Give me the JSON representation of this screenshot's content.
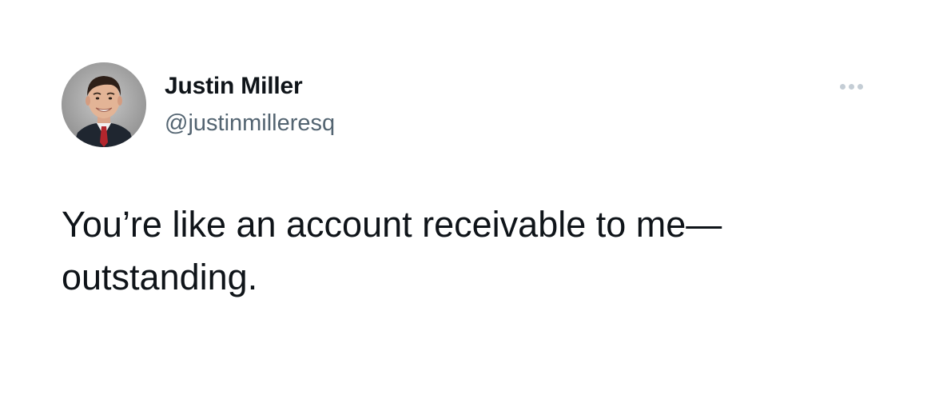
{
  "tweet": {
    "author": {
      "display_name": "Justin Miller",
      "handle": "@justinmilleresq",
      "avatar_icon": "user-avatar-photo"
    },
    "more_icon": "more-options-icon",
    "text": "You’re like an account receivable to me—\noutstanding."
  },
  "colors": {
    "background": "#ffffff",
    "text_primary": "#0f1419",
    "text_secondary": "#536471",
    "more_dots": "#c4cdd5"
  }
}
